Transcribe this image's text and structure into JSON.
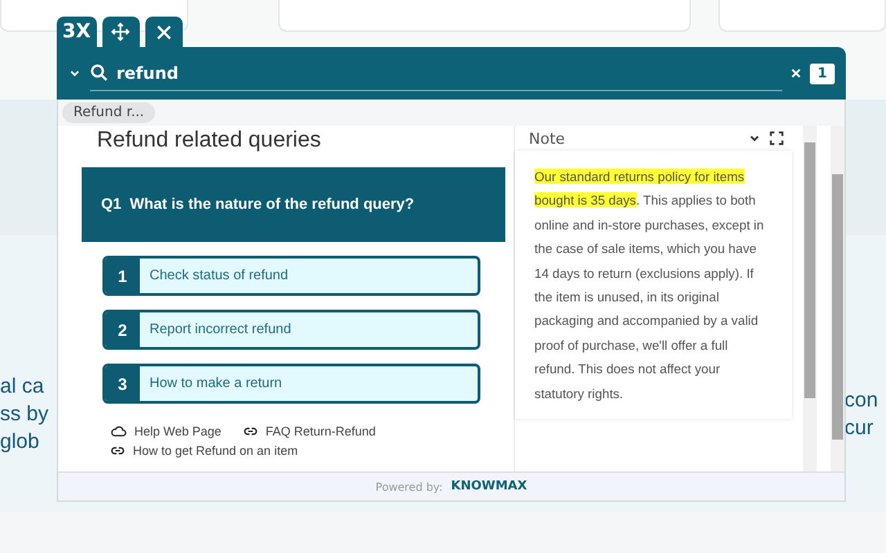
{
  "background": {
    "left_lines": [
      "al ca",
      "ss by",
      "glob"
    ],
    "right_lines": [
      "con",
      "cur"
    ]
  },
  "widget": {
    "tabs": [
      {
        "kind": "zoom",
        "label": "3X"
      },
      {
        "kind": "move"
      },
      {
        "kind": "close"
      }
    ],
    "search": {
      "value": "refund",
      "count": "1"
    },
    "chips": [
      "Refund r..."
    ],
    "title": "Refund related queries",
    "question": "Q1  What is the nature of the refund query?",
    "options": [
      {
        "number": "1",
        "label": "Check status of refund"
      },
      {
        "number": "2",
        "label": "Report incorrect refund"
      },
      {
        "number": "3",
        "label": "How to make a return"
      }
    ],
    "links": [
      {
        "kind": "web",
        "label": "Help Web Page"
      },
      {
        "kind": "link",
        "label": "FAQ Return-Refund"
      },
      {
        "kind": "link",
        "label": "How to get Refund on an item"
      }
    ],
    "note": {
      "title": "Note",
      "highlight": "Our standard returns policy for items bought is 35 days",
      "text": ". This applies to both online and in-store purchases, except in the case of sale items, which you have 14 days to return (exclusions apply). If the item is unused, in its original packaging and accompanied by a valid proof of purchase, we'll offer a full refund. This does not affect your statutory rights."
    },
    "footer": {
      "prefix": "Powered by:",
      "brand": "KNOWMAX"
    }
  }
}
